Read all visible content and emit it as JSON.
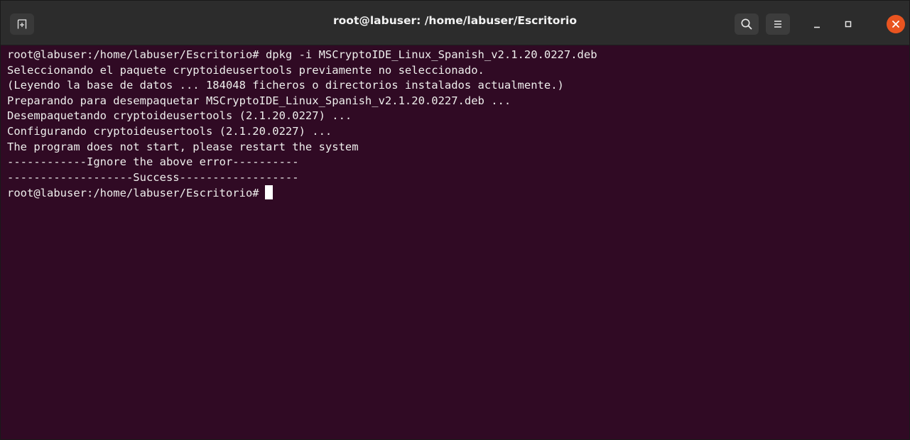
{
  "window": {
    "title": "root@labuser: /home/labuser/Escritorio"
  },
  "titlebar": {
    "new_tab_icon": "new-tab-icon",
    "search_icon": "search-icon",
    "menu_icon": "hamburger-menu-icon",
    "minimize_icon": "minimize-icon",
    "maximize_icon": "maximize-icon",
    "close_icon": "close-icon"
  },
  "colors": {
    "terminal_bg": "#300a24",
    "titlebar_bg": "#2c2c2c",
    "close_accent": "#e95420",
    "text": "#eeeeec"
  },
  "terminal": {
    "lines": [
      "root@labuser:/home/labuser/Escritorio# dpkg -i MSCryptoIDE_Linux_Spanish_v2.1.20.0227.deb",
      "Seleccionando el paquete cryptoideusertools previamente no seleccionado.",
      "(Leyendo la base de datos ... 184048 ficheros o directorios instalados actualmente.)",
      "Preparando para desempaquetar MSCryptoIDE_Linux_Spanish_v2.1.20.0227.deb ...",
      "Desempaquetando cryptoideusertools (2.1.20.0227) ...",
      "Configurando cryptoideusertools (2.1.20.0227) ...",
      "The program does not start, please restart the system",
      "------------Ignore the above error----------",
      "-------------------Success------------------"
    ],
    "prompt": "root@labuser:/home/labuser/Escritorio#"
  }
}
